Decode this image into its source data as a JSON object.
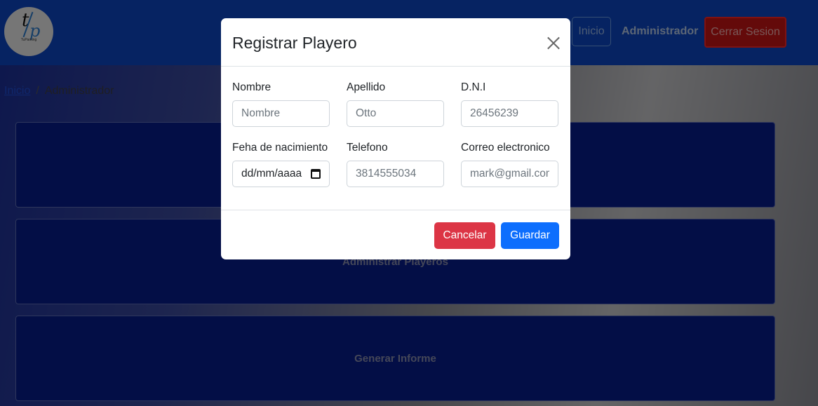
{
  "navbar": {
    "logo_text": "TuParking",
    "links": {
      "inicio": "Inicio",
      "admin": "Administrador"
    },
    "logout_label": "Cerrar Sesion"
  },
  "breadcrumb": {
    "home": "Inicio",
    "separator": "/",
    "current": "Administrador"
  },
  "cards": [
    {
      "label": ""
    },
    {
      "label": "Administrar Playeros"
    },
    {
      "label": "Generar Informe"
    }
  ],
  "modal": {
    "title": "Registrar Playero",
    "fields": {
      "nombre": {
        "label": "Nombre",
        "placeholder": "Nombre",
        "value": ""
      },
      "apellido": {
        "label": "Apellido",
        "placeholder": "Otto",
        "value": ""
      },
      "dni": {
        "label": "D.N.I",
        "placeholder": "26456239",
        "value": ""
      },
      "nacimiento": {
        "label": "Feha de nacimiento",
        "value": "dd/mm/aaaa"
      },
      "telefono": {
        "label": "Telefono",
        "placeholder": "3814555034",
        "value": ""
      },
      "correo": {
        "label": "Correo electronico",
        "placeholder": "mark@gmail.com",
        "value": ""
      }
    },
    "buttons": {
      "cancel": "Cancelar",
      "save": "Guardar"
    }
  },
  "colors": {
    "navbar": "#0d47c4",
    "card": "#071d8c",
    "danger": "#dc3545",
    "primary": "#0d6efd",
    "logout": "#c81515"
  }
}
